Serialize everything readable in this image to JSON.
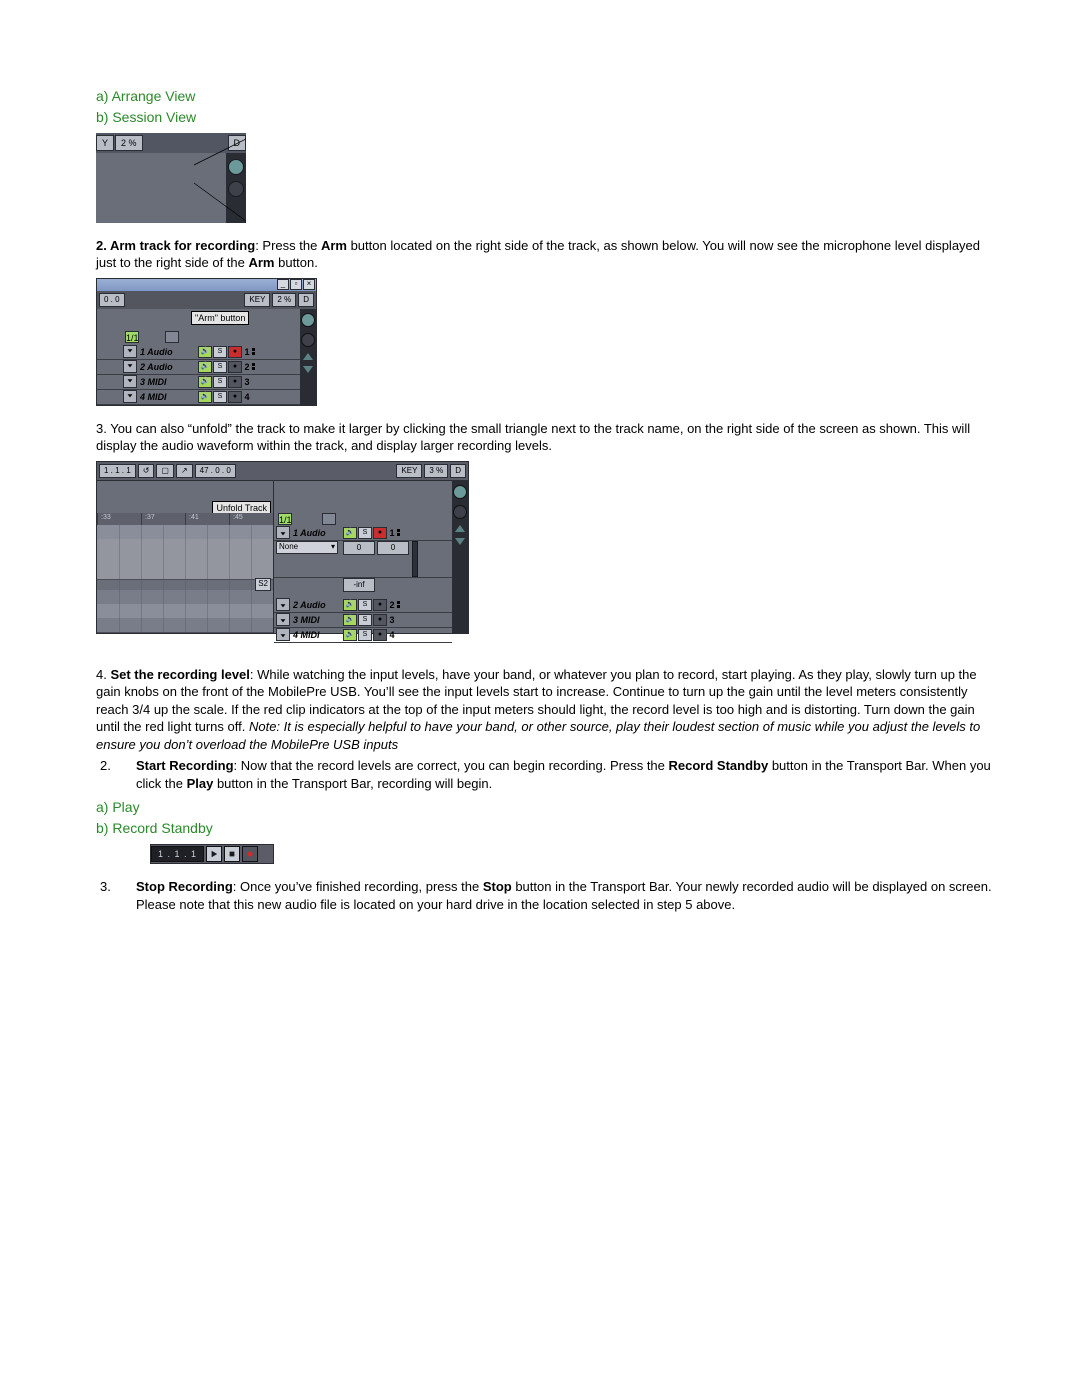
{
  "views": {
    "a": "a) Arrange View",
    "b": "b) Session View"
  },
  "shot1": {
    "pct": "2 %",
    "d": "D"
  },
  "step2": {
    "lead": "2. Arm track for recording",
    "text1": ": Press the ",
    "arm1": "Arm",
    "text2": " button located on the right side of the track, as shown below. You will now see the microphone level displayed just to the right side of the ",
    "arm2": "Arm",
    "text3": " button."
  },
  "shot2": {
    "topleft": "0 . 0",
    "key": "KEY",
    "pct": "2 %",
    "d": "D",
    "label": "\"Arm\" button",
    "meta1": "1/1",
    "tracks": [
      {
        "name": "1 Audio",
        "num": "1",
        "armed": true,
        "io": true
      },
      {
        "name": "2 Audio",
        "num": "2",
        "armed": false,
        "io": true
      },
      {
        "name": "3 MIDI",
        "num": "3",
        "armed": false,
        "io": false
      },
      {
        "name": "4 MIDI",
        "num": "4",
        "armed": false,
        "io": false
      }
    ]
  },
  "step3": "3. You can also “unfold” the track to make it larger by clicking the small triangle next to the track name, on the right side of the screen as shown. This will display the audio waveform within the track, and display larger recording levels.",
  "shot3": {
    "pos": "1 . 1 . 1",
    "beats": "47 . 0 . 0",
    "key": "KEY",
    "pct": "3 %",
    "d": "D",
    "label": "Unfold Track",
    "ruler": [
      ":33",
      ":37",
      ":41",
      ":45"
    ],
    "meta1": "1/1",
    "meta2": "S2",
    "none": "None",
    "zero": "0",
    "inf": "-inf",
    "tracks": [
      {
        "name": "1 Audio",
        "num": "1",
        "armed": true,
        "io": true
      },
      {
        "name": "2 Audio",
        "num": "2",
        "armed": false,
        "io": true
      },
      {
        "name": "3 MIDI",
        "num": "3",
        "armed": false,
        "io": false
      },
      {
        "name": "4 MIDI",
        "num": "4",
        "armed": false,
        "io": false
      }
    ]
  },
  "step4": {
    "pre": "4. ",
    "bold": "Set the recording level",
    "body": ": While watching the input levels, have your band, or whatever you plan to record, start playing. As they play, slowly turn up the gain knobs on the front of the MobilePre USB. You’ll see the input levels start to increase. Continue to turn up the gain until the level meters consistently reach 3/4 up the scale. If the red clip indicators at the top of the input meters should light, the record level is too high and is distorting. Turn down the gain until the red light turns off. ",
    "ital": "Note: It is especially helpful to have your band, or other source, play their loudest section of music while you adjust the levels to ensure you don’t overload the MobilePre USB inputs"
  },
  "list2": {
    "num": "2.",
    "bold1": "Start Recording",
    "t1": ": Now that the record levels are correct, you can begin recording. Press the ",
    "bold2": "Record Standby",
    "t2": " button in the Transport Bar. When you click the ",
    "bold3": "Play",
    "t3": " button in the Transport Bar, recording will begin."
  },
  "controls": {
    "a": "a) Play",
    "b": "b) Record Standby"
  },
  "shot4": {
    "pos": "1 . 1 . 1"
  },
  "list3": {
    "num": "3.",
    "bold1": "Stop Recording",
    "t1": ": Once you’ve finished recording, press the ",
    "bold2": "Stop",
    "t2": " button in the Transport Bar. Your newly recorded audio will be displayed on screen. Please note that this new audio file is located on your hard drive in the location selected in step 5 above."
  }
}
